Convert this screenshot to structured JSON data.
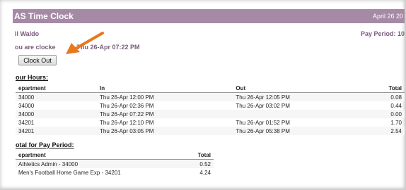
{
  "banner": {
    "title": "AS Time Clock",
    "date": "April 26 20"
  },
  "user": {
    "name": "ll Waldo",
    "pay_period": "Pay Period: 10"
  },
  "status": {
    "prefix": "ou are clocke",
    "suffix": "Thu 26-Apr 07:22 PM"
  },
  "clock_button": {
    "label": "Clock Out"
  },
  "hours": {
    "heading": "our Hours:",
    "columns": [
      "epartment",
      "In",
      "Out",
      "Total"
    ],
    "rows": [
      {
        "dept": "34000",
        "in": "Thu 26-Apr 12:00 PM",
        "out": "Thu 26-Apr 12:05 PM",
        "total": "0.08"
      },
      {
        "dept": "34000",
        "in": "Thu 26-Apr 02:36 PM",
        "out": "Thu 26-Apr 03:02 PM",
        "total": "0.44"
      },
      {
        "dept": "34000",
        "in": "Thu 26-Apr 07:22 PM",
        "out": "",
        "total": "0.00"
      },
      {
        "dept": "34201",
        "in": "Thu 26-Apr 12:10 PM",
        "out": "Thu 26-Apr 01:52 PM",
        "total": "1.70"
      },
      {
        "dept": "34201",
        "in": "Thu 26-Apr 03:05 PM",
        "out": "Thu 26-Apr 05:38 PM",
        "total": "2.54"
      }
    ]
  },
  "pay_period_totals": {
    "heading": "otal for Pay Period:",
    "columns": [
      "epartment",
      "Total"
    ],
    "rows": [
      {
        "dept": "Athletics Admin - 34000",
        "total": "0.52"
      },
      {
        "dept": "Men's Football Home Game Exp - 34201",
        "total": "4.24"
      }
    ]
  },
  "colors": {
    "banner": "#a58aa6",
    "accent_text": "#7a5a7c",
    "arrow": "#e8781e"
  },
  "icons": {
    "annotation": "orange-arrow-icon"
  }
}
